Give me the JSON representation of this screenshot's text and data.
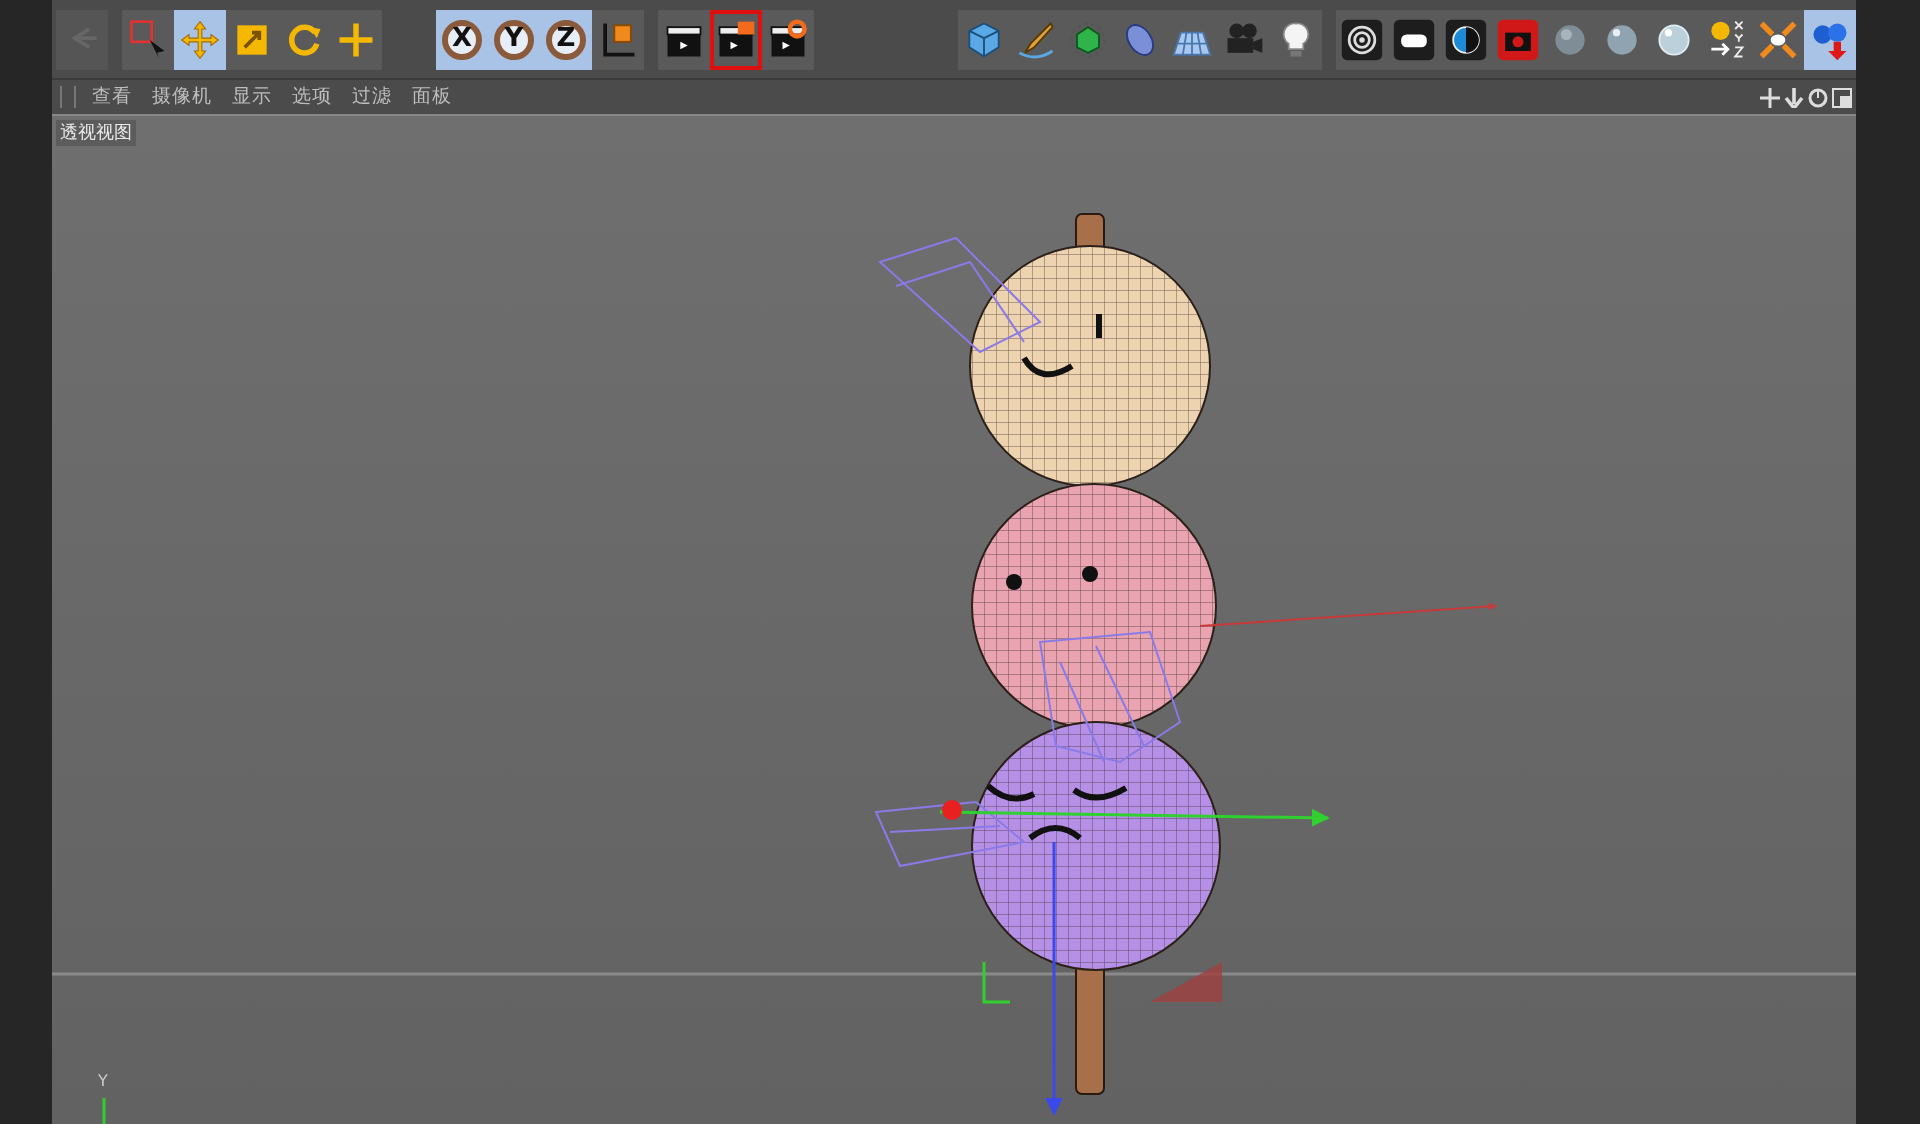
{
  "toolbar": {
    "groups": [
      {
        "tools": [
          {
            "kind": "undo",
            "disabled": true,
            "selected": false,
            "outlined": false
          }
        ]
      },
      {
        "tools": [
          {
            "kind": "select",
            "disabled": false,
            "selected": false,
            "outlined": false
          },
          {
            "kind": "move",
            "disabled": false,
            "selected": true,
            "outlined": false
          },
          {
            "kind": "scale",
            "disabled": false,
            "selected": false,
            "outlined": false
          },
          {
            "kind": "rotate",
            "disabled": false,
            "selected": false,
            "outlined": false
          },
          {
            "kind": "add",
            "disabled": false,
            "selected": false,
            "outlined": false
          }
        ]
      },
      {
        "tools": [
          {
            "kind": "axis",
            "label": "X",
            "disabled": false,
            "selected": true,
            "outlined": false
          },
          {
            "kind": "axis",
            "label": "Y",
            "disabled": false,
            "selected": true,
            "outlined": false
          },
          {
            "kind": "axis",
            "label": "Z",
            "disabled": false,
            "selected": true,
            "outlined": false
          },
          {
            "kind": "coords",
            "disabled": false,
            "selected": false,
            "outlined": false
          }
        ]
      },
      {
        "tools": [
          {
            "kind": "render_view",
            "disabled": false,
            "selected": false,
            "outlined": false
          },
          {
            "kind": "render_picture",
            "disabled": false,
            "selected": false,
            "outlined": true
          },
          {
            "kind": "render_settings",
            "disabled": false,
            "selected": false,
            "outlined": false
          }
        ]
      },
      {
        "tools": [
          {
            "kind": "cube",
            "disabled": false,
            "selected": false,
            "outlined": false
          },
          {
            "kind": "pen",
            "disabled": false,
            "selected": false,
            "outlined": false
          },
          {
            "kind": "subdivide",
            "disabled": false,
            "selected": false,
            "outlined": false
          },
          {
            "kind": "deformer",
            "disabled": false,
            "selected": false,
            "outlined": false
          },
          {
            "kind": "floor",
            "disabled": false,
            "selected": false,
            "outlined": false
          },
          {
            "kind": "camera",
            "disabled": false,
            "selected": false,
            "outlined": false
          },
          {
            "kind": "light",
            "disabled": false,
            "selected": false,
            "outlined": false
          }
        ]
      },
      {
        "tools": [
          {
            "kind": "rings",
            "disabled": false,
            "selected": false,
            "outlined": false
          },
          {
            "kind": "pill",
            "disabled": false,
            "selected": false,
            "outlined": false
          },
          {
            "kind": "contrast",
            "disabled": false,
            "selected": false,
            "outlined": false
          },
          {
            "kind": "photo",
            "disabled": false,
            "selected": false,
            "outlined": false
          },
          {
            "kind": "sphere_matte",
            "disabled": false,
            "selected": false,
            "outlined": false
          },
          {
            "kind": "sphere_gloss",
            "disabled": false,
            "selected": false,
            "outlined": false
          },
          {
            "kind": "sphere_glass",
            "disabled": false,
            "selected": false,
            "outlined": false
          },
          {
            "kind": "sun_xyz",
            "disabled": false,
            "selected": false,
            "outlined": false
          },
          {
            "kind": "burst",
            "disabled": false,
            "selected": false,
            "outlined": false
          },
          {
            "kind": "spheres_down",
            "disabled": false,
            "selected": true,
            "outlined": false
          }
        ]
      }
    ]
  },
  "viewport_menu": [
    {
      "label": "查看"
    },
    {
      "label": "摄像机"
    },
    {
      "label": "显示"
    },
    {
      "label": "选项"
    },
    {
      "label": "过滤"
    },
    {
      "label": "面板"
    }
  ],
  "viewport": {
    "title": "透视视图",
    "axis_label": "Y"
  }
}
